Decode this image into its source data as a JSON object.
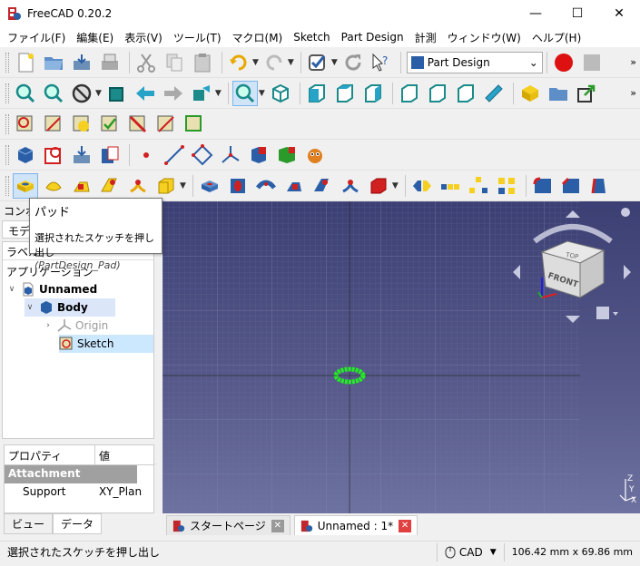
{
  "window": {
    "title": "FreeCAD 0.20.2",
    "minimize": "—",
    "maximize": "☐",
    "close": "✕"
  },
  "menu": [
    "ファイル(F)",
    "編集(E)",
    "表示(V)",
    "ツール(T)",
    "マクロ(M)",
    "Sketch",
    "Part Design",
    "計測",
    "ウィンドウ(W)",
    "ヘルプ(H)"
  ],
  "workbench": {
    "selected": "Part Design"
  },
  "left_panel": {
    "combo_tab": "コンボ",
    "model_tab": "モデ",
    "label_header": "ラベル",
    "applications_label": "アプリケーション",
    "tree": [
      {
        "label": "Unnamed"
      },
      {
        "label": "Body"
      },
      {
        "label": "Origin"
      },
      {
        "label": "Sketch"
      }
    ],
    "props_header_property": "プロパティ",
    "props_header_value": "値",
    "props_group": "Attachment",
    "props_row_name": "Support",
    "props_row_value": "XY_Plan",
    "view_tab": "ビュー",
    "data_tab": "データ"
  },
  "tooltip": {
    "title": "パッド",
    "description": "選択されたスケッチを押し出し",
    "command": "(PartDesign_Pad)"
  },
  "navcube": {
    "top": "TOP",
    "front": "FRONT"
  },
  "axis": {
    "z": "Z",
    "y": "Y",
    "x": "X"
  },
  "doc_tabs": [
    {
      "label": "スタートページ"
    },
    {
      "label": "Unnamed : 1*"
    }
  ],
  "status": {
    "message": "選択されたスケッチを押し出し",
    "nav_mode": "CAD",
    "dimensions": "106.42 mm x 69.86 mm"
  },
  "colors": {
    "sketch": "#22ee22",
    "view_bg": "#4a4d7f",
    "record": "#dd1111"
  }
}
